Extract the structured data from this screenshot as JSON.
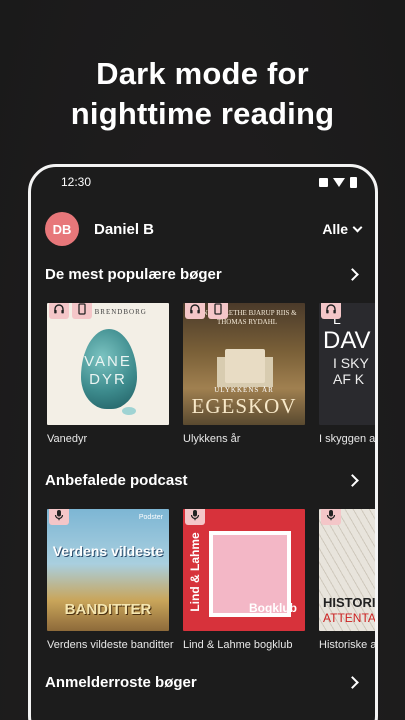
{
  "headline": {
    "line1": "Dark mode for",
    "line2": "nighttime reading"
  },
  "status_bar": {
    "time": "12:30"
  },
  "profile": {
    "initials": "DB",
    "name": "Daniel B",
    "filter_label": "Alle"
  },
  "sections": [
    {
      "title": "De mest populære bøger",
      "items": [
        {
          "title": "Vanedyr",
          "cover_text": [
            "VANE",
            "DYR"
          ],
          "cover_top": "S BRENDBORG",
          "badges": [
            "headphones-icon",
            "phone-icon"
          ]
        },
        {
          "title": "Ulykkens år",
          "cover_top": "ANNE-GRETHE BJARUP RIIS & THOMAS RYDAHL",
          "cover_text": [
            "ULYKKENS ÅR",
            "EGESKOV"
          ],
          "badges": [
            "headphones-icon",
            "phone-icon"
          ]
        },
        {
          "title": "I skyggen af",
          "cover_text": [
            "L",
            "DAV",
            "I SKY",
            "AF K"
          ],
          "badges": [
            "headphones-icon"
          ]
        }
      ]
    },
    {
      "title": "Anbefalede podcast",
      "items": [
        {
          "title": "Verdens vildeste banditter",
          "cover_text": [
            "Verdens vildeste",
            "BANDITTER"
          ],
          "cover_top": "Podster",
          "badges": [
            "microphone-icon"
          ]
        },
        {
          "title": "Lind & Lahme bogklub",
          "cover_text": [
            "Lind & Lahme",
            "Bogklub"
          ],
          "badges": [
            "microphone-icon"
          ]
        },
        {
          "title": "Historiske a",
          "cover_text": [
            "HISTORI",
            "ATTENTA"
          ],
          "badges": [
            "microphone-icon"
          ]
        }
      ]
    },
    {
      "title": "Anmelderroste bøger"
    }
  ],
  "colors": {
    "avatar": "#e7777a",
    "badge": "#f4c6c8",
    "podcast_red": "#d7323b"
  }
}
